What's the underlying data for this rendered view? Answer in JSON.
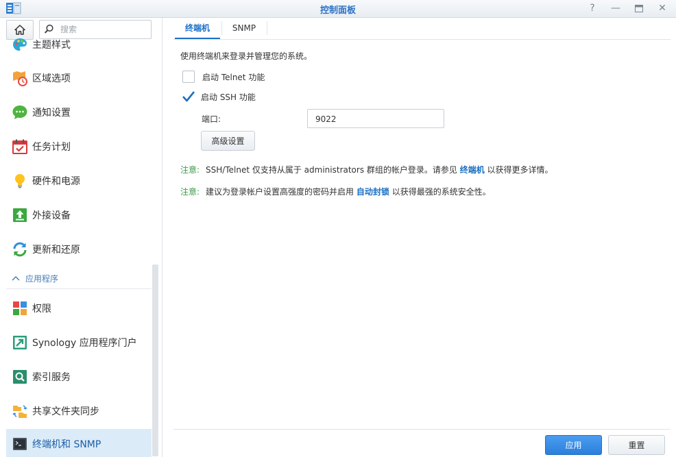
{
  "window": {
    "title": "控制面板",
    "help_glyph": "?",
    "minimize_glyph": "—",
    "close_glyph": "✕"
  },
  "sidebar": {
    "search_placeholder": "搜索",
    "items": [
      {
        "label": "主题样式",
        "icon": "palette-icon"
      },
      {
        "label": "区域选项",
        "icon": "region-clock-icon"
      },
      {
        "label": "通知设置",
        "icon": "chat-bubble-icon"
      },
      {
        "label": "任务计划",
        "icon": "calendar-check-icon"
      },
      {
        "label": "硬件和电源",
        "icon": "lightbulb-icon"
      },
      {
        "label": "外接设备",
        "icon": "upload-arrow-icon"
      },
      {
        "label": "更新和还原",
        "icon": "refresh-icon"
      }
    ],
    "section_label": "应用程序",
    "app_items": [
      {
        "label": "权限",
        "icon": "permissions-grid-icon"
      },
      {
        "label": "Synology 应用程序门户",
        "icon": "portal-arrow-icon"
      },
      {
        "label": "索引服务",
        "icon": "search-index-icon"
      },
      {
        "label": "共享文件夹同步",
        "icon": "folder-sync-icon"
      },
      {
        "label": "终端机和 SNMP",
        "icon": "terminal-icon",
        "active": true
      }
    ]
  },
  "tabs": [
    {
      "label": "终端机",
      "active": true
    },
    {
      "label": "SNMP",
      "active": false
    }
  ],
  "content": {
    "description": "使用终端机来登录并管理您的系统。",
    "telnet_label": "启动 Telnet 功能",
    "telnet_checked": false,
    "ssh_label": "启动 SSH 功能",
    "ssh_checked": true,
    "port_label": "端口:",
    "port_value": "9022",
    "advanced_button": "高级设置",
    "note1": {
      "prefix": "注意:",
      "text_before": "SSH/Telnet 仅支持从属于 administrators 群组的帐户登录。请参见 ",
      "link": "终端机",
      "text_after": " 以获得更多详情。"
    },
    "note2": {
      "prefix": "注意:",
      "text_before": "建议为登录帐户设置高强度的密码并启用 ",
      "link": "自动封锁",
      "text_after": " 以获得最强的系统安全性。"
    }
  },
  "footer": {
    "apply_label": "应用",
    "reset_label": "重置"
  },
  "colors": {
    "accent": "#1a6fc4",
    "note_prefix": "#3c9b4b",
    "active_item_bg": "#dcebf8",
    "title": "#2b72c6"
  }
}
